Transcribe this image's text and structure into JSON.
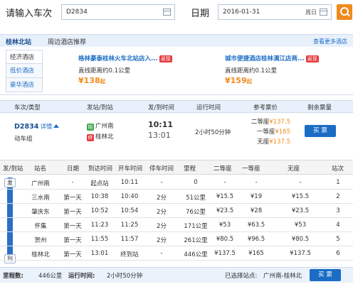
{
  "search": {
    "train_label": "请输入车次",
    "train_value": "D2834",
    "date_label": "日期",
    "date_value": "2016-01-31",
    "weekday": "周日"
  },
  "hotel": {
    "station": "桂林北站",
    "subtitle": "周边酒店推荐",
    "more_link": "查看更多酒店",
    "tabs": [
      "经济酒店",
      "低价酒店",
      "豪华酒店"
    ],
    "cards": [
      {
        "name": "格林豪泰桂林火车北站店入...",
        "tag": "返现",
        "distance": "直线距离约0.1公里",
        "price": "¥138",
        "price_suffix": "起"
      },
      {
        "name": "城市便捷酒店桂林漓江店商...",
        "tag": "返现",
        "distance": "直线距离约0.1公里",
        "price": "¥159",
        "price_suffix": "起"
      }
    ]
  },
  "train_table": {
    "headers": [
      "车次/类型",
      "发站/到站",
      "发/到时间",
      "运行时间",
      "参考票价",
      "剩余票量"
    ],
    "row": {
      "number": "D2834",
      "detail": "详情",
      "type": "动车组",
      "from_icon": "始",
      "from": "广州南",
      "to_icon": "终",
      "to": "桂林北",
      "depart": "10:11",
      "arrive": "13:01",
      "duration": "2小时50分钟",
      "fares": [
        {
          "label": "二等座",
          "price": "¥137.5"
        },
        {
          "label": "一等座",
          "price": "¥165"
        },
        {
          "label": "无座",
          "price": "¥137.5"
        }
      ],
      "buy_label": "买 票"
    }
  },
  "stop_table": {
    "headers": [
      "发/到站",
      "站名",
      "日期",
      "到达时间",
      "开车时间",
      "停车时间",
      "里程",
      "二等座",
      "一等座",
      "无座",
      "站次"
    ],
    "rail_start": "发",
    "rail_end": "到",
    "rows": [
      {
        "name": "广州南",
        "day": "-",
        "arrive": "起点站",
        "depart": "10:11",
        "stop": "-",
        "dist": "0",
        "second": "-",
        "first": "-",
        "none": "-",
        "idx": "1"
      },
      {
        "name": "三水南",
        "day": "第一天",
        "arrive": "10:38",
        "depart": "10:40",
        "stop": "2分",
        "dist": "51公里",
        "second": "¥15.5",
        "first": "¥19",
        "none": "¥15.5",
        "idx": "2"
      },
      {
        "name": "肇庆东",
        "day": "第一天",
        "arrive": "10:52",
        "depart": "10:54",
        "stop": "2分",
        "dist": "76公里",
        "second": "¥23.5",
        "first": "¥28",
        "none": "¥23.5",
        "idx": "3"
      },
      {
        "name": "怀集",
        "day": "第一天",
        "arrive": "11:23",
        "depart": "11:25",
        "stop": "2分",
        "dist": "171公里",
        "second": "¥53",
        "first": "¥63.5",
        "none": "¥53",
        "idx": "4"
      },
      {
        "name": "贺州",
        "day": "第一天",
        "arrive": "11:55",
        "depart": "11:57",
        "stop": "2分",
        "dist": "261公里",
        "second": "¥80.5",
        "first": "¥96.5",
        "none": "¥80.5",
        "idx": "5"
      },
      {
        "name": "桂林北",
        "day": "第一天",
        "arrive": "13:01",
        "depart": "终到站",
        "stop": "-",
        "dist": "446公里",
        "second": "¥137.5",
        "first": "¥165",
        "none": "¥137.5",
        "idx": "6"
      }
    ]
  },
  "footer": {
    "distance_label": "里程数:",
    "distance": "446公里",
    "runtime_label": "运行时间:",
    "runtime": "2小时50分钟",
    "selected_label": "已选择站点:",
    "selected": "广州南-桂林北",
    "buy_label": "买 票"
  }
}
